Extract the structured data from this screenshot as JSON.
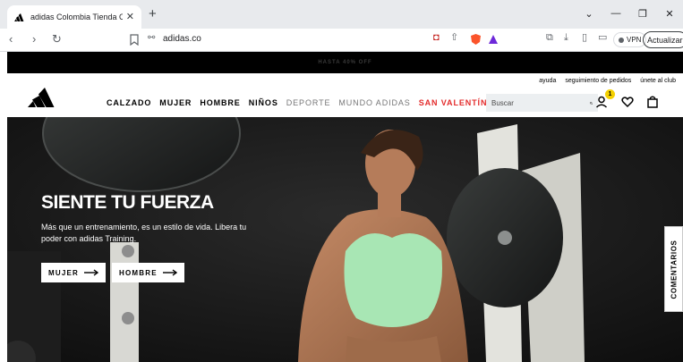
{
  "browser": {
    "tab_title": "adidas Colombia Tienda Oficial",
    "url": "adidas.co",
    "vpn_label": "VPN",
    "update_label": "Actualizar"
  },
  "promo": {
    "text": "HASTA 40% OFF"
  },
  "header": {
    "util_links": [
      "ayuda",
      "seguimiento de pedidos",
      "únete al club"
    ],
    "nav": [
      {
        "label": "CALZADO",
        "style": "bold"
      },
      {
        "label": "MUJER",
        "style": "bold"
      },
      {
        "label": "HOMBRE",
        "style": "bold"
      },
      {
        "label": "NIÑOS",
        "style": "bold"
      },
      {
        "label": "DEPORTE",
        "style": "muted"
      },
      {
        "label": "MUNDO ADIDAS",
        "style": "muted"
      },
      {
        "label": "SAN VALENTÍN",
        "style": "sale"
      }
    ],
    "search_placeholder": "Buscar",
    "account_badge": "1"
  },
  "hero": {
    "title": "SIENTE TU FUERZA",
    "subtitle": "Más que un entrenamiento, es un estilo de vida. Libera tu poder con adidas Training.",
    "cta_women": "MUJER",
    "cta_men": "HOMBRE"
  },
  "feedback": {
    "label": "COMENTARIOS"
  },
  "colors": {
    "brand_black": "#000000",
    "sale_red": "#e32b2b",
    "badge_yellow": "#f5d100",
    "hero_top_green": "#a8e6b4"
  }
}
